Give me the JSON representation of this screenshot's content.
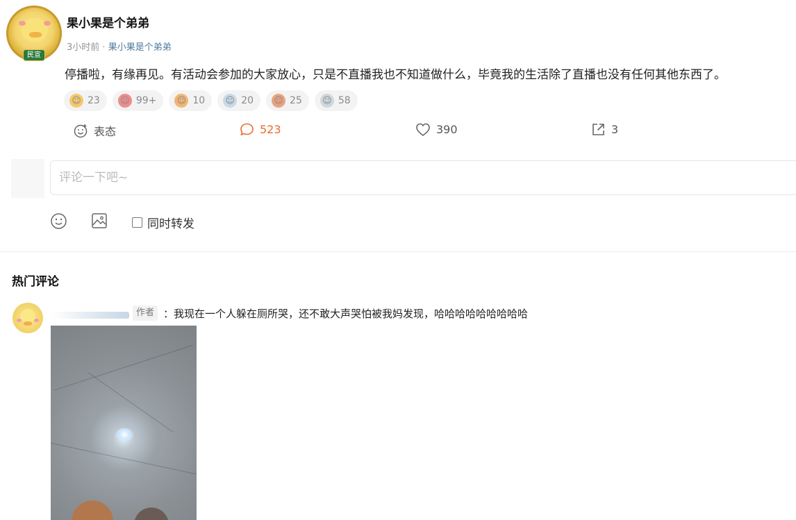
{
  "post": {
    "author": "果小果是个弟弟",
    "badge": "民宣",
    "time": "3小时前",
    "separator": "·",
    "source": "果小果是个弟弟",
    "content": "停播啦，有缘再见。有活动会参加的大家放心，只是不直播我也不知道做什么，毕竟我的生活除了直播也没有任何其他东西了。"
  },
  "reactions": [
    {
      "icon": "reaction-emoji-1",
      "count": "23",
      "color": "#f5c96b"
    },
    {
      "icon": "reaction-emoji-2",
      "count": "99+",
      "color": "#ef8c8c"
    },
    {
      "icon": "reaction-emoji-3",
      "count": "10",
      "color": "#f2b673"
    },
    {
      "icon": "reaction-emoji-4",
      "count": "20",
      "color": "#c9d9e6"
    },
    {
      "icon": "reaction-emoji-5",
      "count": "25",
      "color": "#e9a27e"
    },
    {
      "icon": "reaction-emoji-6",
      "count": "58",
      "color": "#cfd8de"
    }
  ],
  "actions": {
    "react_label": "表态",
    "comments": "523",
    "likes": "390",
    "shares": "3"
  },
  "composer": {
    "placeholder": "评论一下吧~",
    "repost_label": "同时转发"
  },
  "hot_comments": {
    "title": "热门评论",
    "items": [
      {
        "author_tag": "作者",
        "text": "：我现在一个人躲在厕所哭，还不敢大声哭怕被我妈发现，哈哈哈哈哈哈哈哈哈"
      }
    ]
  },
  "colors": {
    "accent": "#eb6a30",
    "link": "#4c7a9e"
  }
}
